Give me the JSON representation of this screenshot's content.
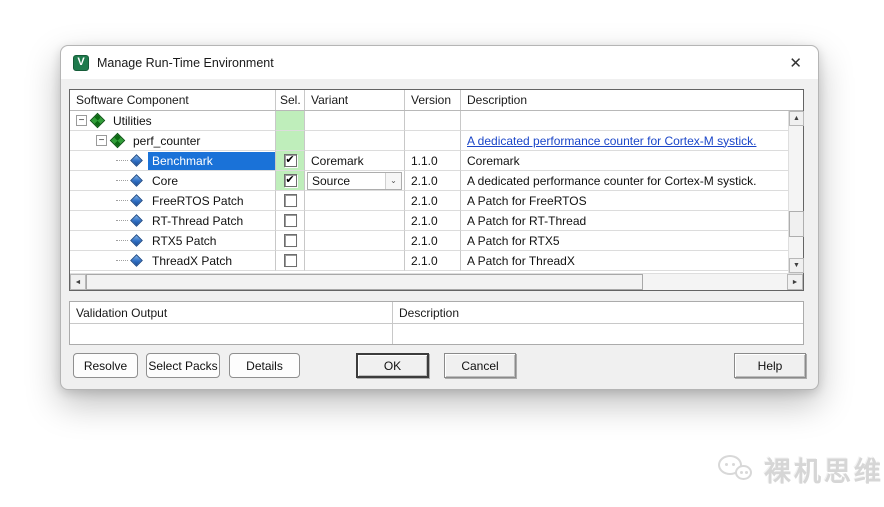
{
  "window": {
    "title": "Manage Run-Time Environment",
    "close_glyph": "✕",
    "app_icon_glyph": "V"
  },
  "table": {
    "headers": [
      "Software Component",
      "Sel.",
      "Variant",
      "Version",
      "Description"
    ],
    "rows": [
      {
        "label": "Utilities",
        "level": 0,
        "kind": "group",
        "expanded": true,
        "sel_green": true,
        "checked": null,
        "variant": "",
        "variant_dropdown": false,
        "version": "",
        "description": "",
        "desc_link": false,
        "selected": false
      },
      {
        "label": "perf_counter",
        "level": 1,
        "kind": "group",
        "expanded": true,
        "sel_green": true,
        "checked": null,
        "variant": "",
        "variant_dropdown": false,
        "version": "",
        "description": "A dedicated performance counter for Cortex-M systick.",
        "desc_link": true,
        "selected": false
      },
      {
        "label": "Benchmark",
        "level": 2,
        "kind": "leaf",
        "expanded": null,
        "sel_green": false,
        "checked": true,
        "variant": "Coremark",
        "variant_dropdown": false,
        "version": "1.1.0",
        "description": "Coremark",
        "desc_link": false,
        "selected": true
      },
      {
        "label": "Core",
        "level": 2,
        "kind": "leaf",
        "expanded": null,
        "sel_green": false,
        "checked": true,
        "variant": "Source",
        "variant_dropdown": true,
        "version": "2.1.0",
        "description": "A dedicated performance counter for Cortex-M systick.",
        "desc_link": false,
        "selected": false
      },
      {
        "label": "FreeRTOS Patch",
        "level": 2,
        "kind": "leaf",
        "expanded": null,
        "sel_green": false,
        "checked": false,
        "variant": "",
        "variant_dropdown": false,
        "version": "2.1.0",
        "description": "A Patch for FreeRTOS",
        "desc_link": false,
        "selected": false
      },
      {
        "label": "RT-Thread Patch",
        "level": 2,
        "kind": "leaf",
        "expanded": null,
        "sel_green": false,
        "checked": false,
        "variant": "",
        "variant_dropdown": false,
        "version": "2.1.0",
        "description": "A Patch for RT-Thread",
        "desc_link": false,
        "selected": false
      },
      {
        "label": "RTX5 Patch",
        "level": 2,
        "kind": "leaf",
        "expanded": null,
        "sel_green": false,
        "checked": false,
        "variant": "",
        "variant_dropdown": false,
        "version": "2.1.0",
        "description": "A Patch for RTX5",
        "desc_link": false,
        "selected": false
      },
      {
        "label": "ThreadX Patch",
        "level": 2,
        "kind": "leaf",
        "expanded": null,
        "sel_green": false,
        "checked": false,
        "variant": "",
        "variant_dropdown": false,
        "version": "2.1.0",
        "description": "A Patch for ThreadX",
        "desc_link": false,
        "selected": false
      }
    ]
  },
  "validation": {
    "headers": [
      "Validation Output",
      "Description"
    ]
  },
  "buttons": {
    "resolve": "Resolve",
    "select_packs": "Select Packs",
    "details": "Details",
    "ok": "OK",
    "cancel": "Cancel",
    "help": "Help"
  },
  "icons": {
    "scroll_up": "▲",
    "scroll_down": "▼",
    "scroll_left": "◄",
    "scroll_right": "►",
    "checkmark": "✔",
    "collapse": "−",
    "combo_chevron": "⌄"
  },
  "watermark": {
    "text": "裸机思维"
  },
  "colors": {
    "selection_blue": "#1a72d8",
    "checked_green": "#bfeebb",
    "link_blue": "#1b46c8",
    "icon_green": "#1e7a4c"
  }
}
